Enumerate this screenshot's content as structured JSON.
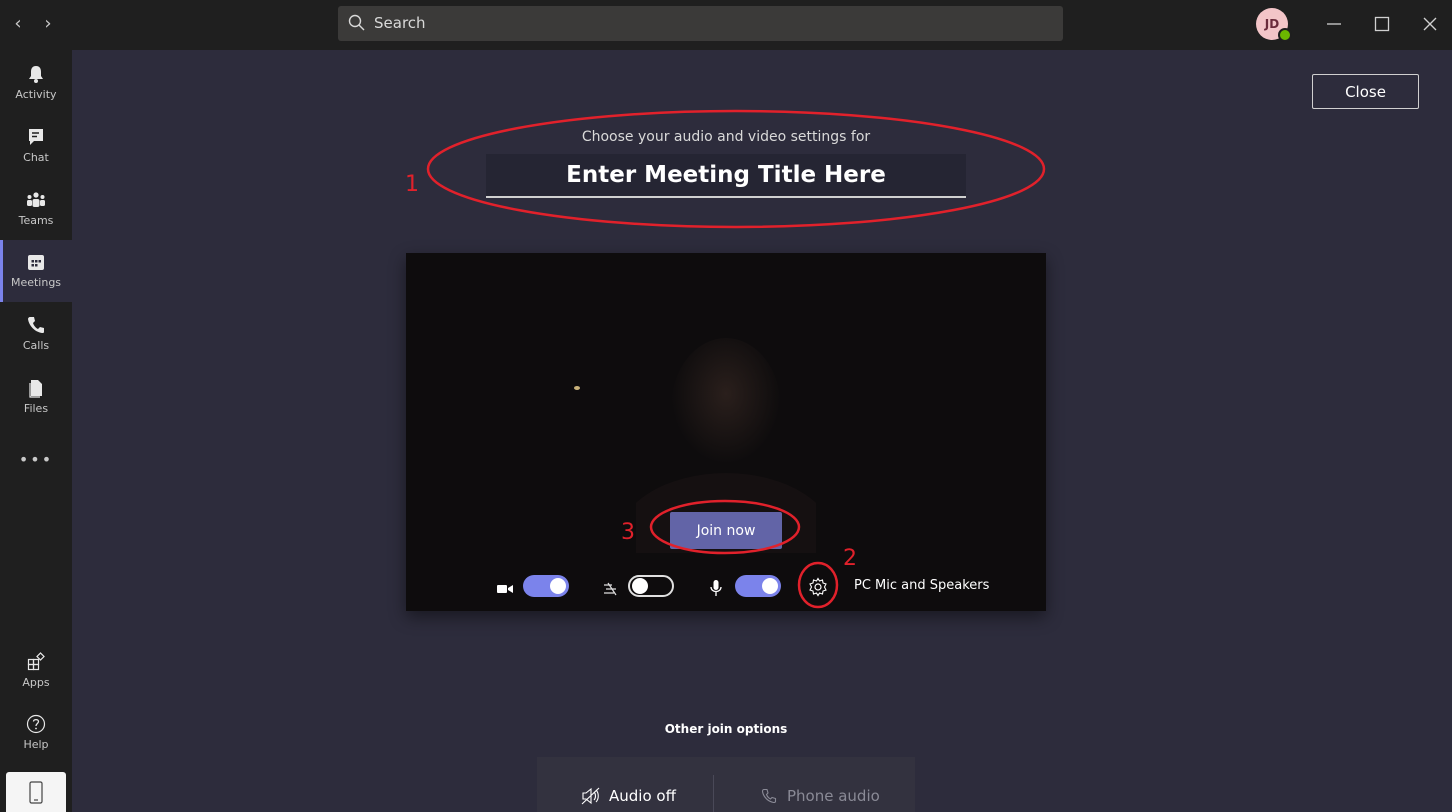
{
  "titlebar": {
    "back_glyph": "‹",
    "forward_glyph": "›",
    "search_placeholder": "Search",
    "avatar_initials": "JD",
    "presence_color": "#6bb700",
    "window_controls": [
      "minimize-icon",
      "maximize-icon",
      "close-icon"
    ]
  },
  "rail": {
    "items": [
      {
        "label": "Activity",
        "icon": "bell-icon"
      },
      {
        "label": "Chat",
        "icon": "chat-icon"
      },
      {
        "label": "Teams",
        "icon": "teams-icon"
      },
      {
        "label": "Meetings",
        "icon": "calendar-icon",
        "active": true
      },
      {
        "label": "Calls",
        "icon": "phone-icon"
      },
      {
        "label": "Files",
        "icon": "file-icon"
      }
    ],
    "more": "•••",
    "bottom": [
      {
        "label": "Apps",
        "icon": "apps-icon"
      },
      {
        "label": "Help",
        "icon": "help-icon"
      }
    ]
  },
  "main": {
    "close_label": "Close",
    "subtitle": "Choose your audio and video settings for",
    "meeting_title": "Enter Meeting Title Here",
    "join_label": "Join now",
    "device_label": "PC Mic and Speakers",
    "controls": {
      "camera_on": true,
      "blur_on": false,
      "mic_on": true
    },
    "other_options_title": "Other join options",
    "options": [
      {
        "label": "Audio off",
        "icon": "speaker-off-icon"
      },
      {
        "label": "Phone audio",
        "icon": "phone-icon"
      }
    ]
  },
  "annotations": [
    "1",
    "2",
    "3"
  ],
  "colors": {
    "accent": "#6264a7",
    "toggle_on": "#7b83eb",
    "annotation": "#e1212b",
    "background": "#2d2c3c",
    "rail": "#1f1f1f"
  }
}
